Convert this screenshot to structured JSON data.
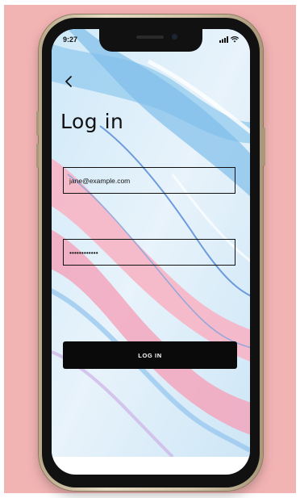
{
  "status_bar": {
    "time": "9:27"
  },
  "icons": {
    "back": "chevron-left-icon",
    "signal": "signal-icon",
    "wifi": "wifi-icon"
  },
  "page": {
    "title": "Log in"
  },
  "form": {
    "email_value": "jane@example.com",
    "password_value": "••••••••••••",
    "submit_label": "LOG IN"
  },
  "colors": {
    "background": "#f2b3b3",
    "button": "#0a0a0a",
    "button_text": "#ffffff",
    "marble_blue": "#8ec7ee",
    "marble_pink": "#f6b7c8"
  }
}
